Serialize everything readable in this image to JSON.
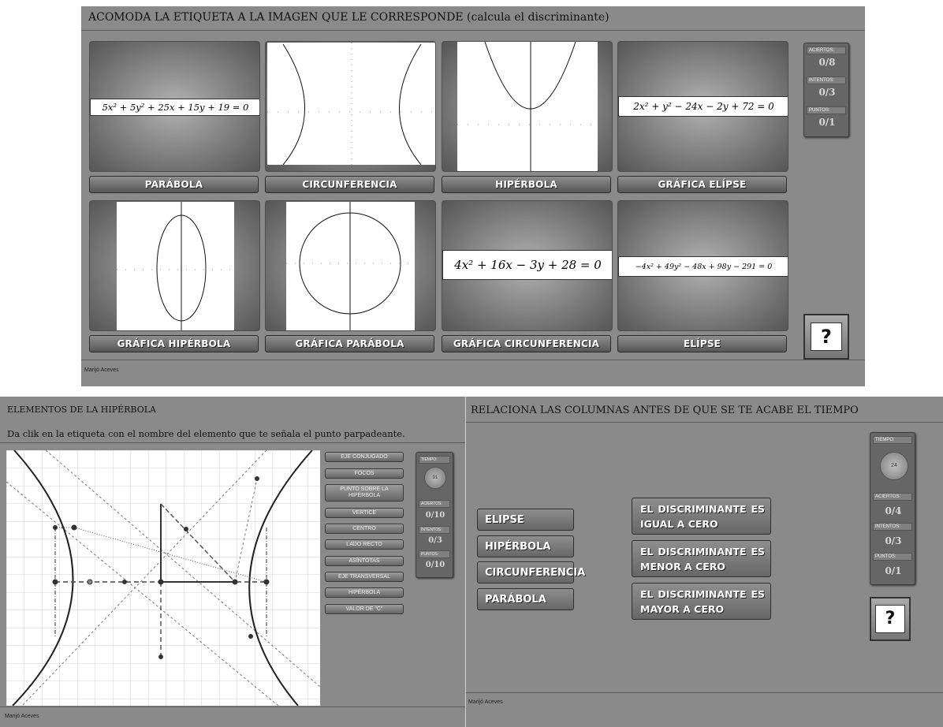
{
  "top": {
    "title": "ACOMODA LA ETIQUETA A LA IMAGEN QUE LE CORRESPONDE",
    "title_note": "(calcula el discriminante)",
    "equations": {
      "eq1": "5x² + 5y² + 25x + 15y + 19 = 0",
      "eq2": "2x² + y² − 24x − 2y + 72 = 0",
      "eq3": "4x² + 16x − 3y + 28 = 0",
      "eq4": "−4x² + 49y² − 48x + 98y − 291 = 0"
    },
    "labels_row1": [
      "PARÁBOLA",
      "CIRCUNFERENCIA",
      "HIPÉRBOLA",
      "GRÁFICA ELÍPSE"
    ],
    "labels_row2": [
      "GRÁFICA HIPÉRBOLA",
      "GRÁFICA PARÁBOLA",
      "GRÁFICA CIRCUNFERENCIA",
      "ELÍPSE"
    ],
    "stats": {
      "aciertos_label": "ACIERTOS:",
      "aciertos": "0/8",
      "intentos_label": "INTENTOS:",
      "intentos": "0/3",
      "puntos_label": "PUNTOS:",
      "puntos": "0/1"
    },
    "help": "?",
    "author": "Marijó Aceves"
  },
  "left": {
    "title": "ELEMENTOS DE LA HIPÉRBOLA",
    "instruction": "Da clik en la etiqueta con el nombre del elemento que te señala el punto parpadeante.",
    "buttons": [
      "EJE CONJUGADO",
      "FOCOS",
      "PUNTO SOBRE LA HIPÉRBOLA",
      "VERTICE",
      "CENTRO",
      "LADO RECTO",
      "ASÍNTOTAS",
      "EJE TRANSVERSAL",
      "HIPÉRBOLA",
      "VALOR DE \"C\""
    ],
    "stats": {
      "tiempo_label": "TIEMPO:",
      "tiempo": "91",
      "aciertos_label": "ACIERTOS:",
      "aciertos": "0/10",
      "intentos_label": "INTENTOS:",
      "intentos": "0/3",
      "puntos_label": "PUNTOS:",
      "puntos": "0/10"
    },
    "author": "Marijó Aceves"
  },
  "right": {
    "title": "RELACIONA LAS COLUMNAS ANTES DE QUE SE TE ACABE EL TIEMPO",
    "left_items": [
      "ELIPSE",
      "HIPÉRBOLA",
      "CIRCUNFERENCIA",
      "PARÁBOLA"
    ],
    "right_items": [
      {
        "line1": "EL DISCRIMINANTE ES",
        "line2": "IGUAL A CERO"
      },
      {
        "line1": "EL DISCRIMINANTE ES",
        "line2": "MENOR A CERO"
      },
      {
        "line1": "EL DISCRIMINANTE ES",
        "line2": "MAYOR A CERO"
      }
    ],
    "stats": {
      "tiempo_label": "TIEMPO:",
      "tiempo": "24",
      "aciertos_label": "ACIERTOS:",
      "aciertos": "0/4",
      "intentos_label": "INTENTOS:",
      "intentos": "0/3",
      "puntos_label": "PUNTOS:",
      "puntos": "0/1"
    },
    "help": "?",
    "author": "Marijó Aceves"
  }
}
